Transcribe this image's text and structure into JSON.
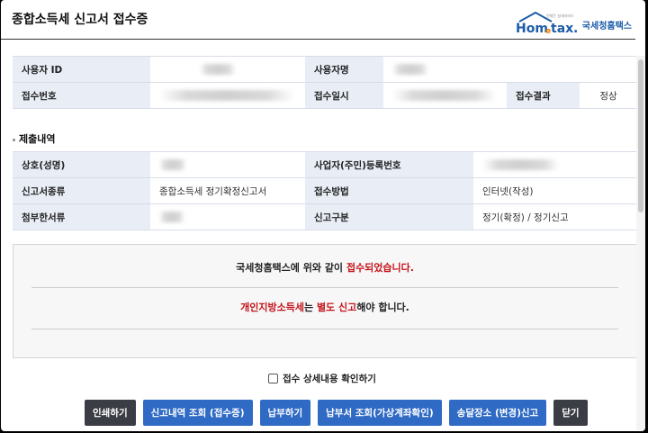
{
  "header": {
    "title": "종합소득세 신고서 접수증",
    "logo_text": "Hometax",
    "logo_sub": "국세청홈택스",
    "logo_tagline": "언제든 실세서비스"
  },
  "receipt": {
    "user_id_label": "사용자 ID",
    "user_id_value": "",
    "user_name_label": "사용자명",
    "user_name_value": "",
    "receipt_no_label": "접수번호",
    "receipt_no_value": "",
    "receipt_time_label": "접수일시",
    "receipt_time_value": "",
    "result_label": "접수결과",
    "result_value": "정상"
  },
  "submission": {
    "section_title": "제출내역",
    "business_name_label": "상호(성명)",
    "business_name_value": "",
    "reg_no_label": "사업자(주민)등록번호",
    "reg_no_value": "",
    "report_type_label": "신고서종류",
    "report_type_value": "종합소득세 정기확정신고서",
    "method_label": "접수방법",
    "method_value": "인터넷(작성)",
    "attachments_label": "첨부한서류",
    "attachments_value": "",
    "category_label": "신고구분",
    "category_value": "정기(확정) / 정기신고"
  },
  "notice": {
    "line1_prefix": "국세청홈택스에 위와 같이 ",
    "line1_highlight": "접수되었습니다.",
    "line2_red1": "개인지방소득세",
    "line2_mid": "는 ",
    "line2_red2": "별도 신고",
    "line2_suffix": "해야 합니다."
  },
  "confirm_label": "접수 상세내용 확인하기",
  "buttons": {
    "print": "인쇄하기",
    "history": "신고내역 조회 (접수증)",
    "pay": "납부하기",
    "bill": "납부서 조회(가상계좌확인)",
    "delivery": "송달장소 (변경)신고",
    "close": "닫기"
  },
  "colors": {
    "accent_blue": "#2f6ac4",
    "dark_button": "#3b3d44",
    "highlight_red": "#c4131a",
    "header_cell": "#e8edf6"
  }
}
